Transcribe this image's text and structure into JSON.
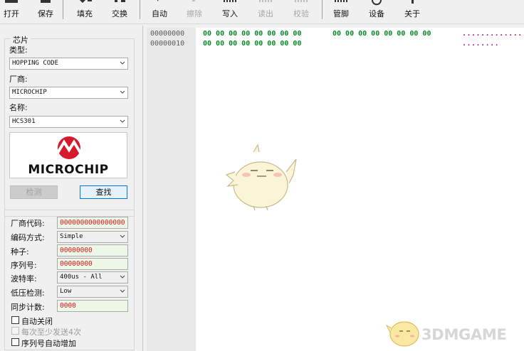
{
  "toolbar": {
    "open": "打开",
    "save": "保存",
    "fill": "填充",
    "swap": "交换",
    "auto": "自动",
    "erase": "擦除",
    "write": "写入",
    "read": "读出",
    "verify": "校验",
    "pins": "管脚",
    "device": "设备",
    "about": "关于"
  },
  "chip": {
    "group_title": "芯片",
    "type_label": "类型:",
    "type_value": "HOPPING CODE",
    "maker_label": "厂商:",
    "maker_value": "MICROCHIP",
    "name_label": "名称:",
    "name_value": "HCS301",
    "logo_text": "MICROCHIP",
    "detect_button": "检测",
    "search_button": "查找"
  },
  "config": {
    "manufacturer_code_label": "厂商代码:",
    "manufacturer_code_value": "0000000000000000",
    "encoding_label": "编码方式:",
    "encoding_value": "Simple",
    "seed_label": "种子:",
    "seed_value": "00000000",
    "serial_label": "序列号:",
    "serial_value": "00000000",
    "baud_label": "波特率:",
    "baud_value": "400us - All",
    "low_voltage_label": "低压检测:",
    "low_voltage_value": "Low",
    "sync_label": "同步计数:",
    "sync_value": "0000",
    "auto_close_label": "自动关闭",
    "send_min_label": "每次至少发送4次",
    "serial_auto_label": "序列号自动增加"
  },
  "hex": {
    "rows": [
      {
        "address": "00000000",
        "bytes_a": "00 00 00 00 00 00 00 00",
        "bytes_b": "00 00 00 00 00 00 00 00",
        "ascii": "................"
      },
      {
        "address": "00000010",
        "bytes_a": "00 00 00 00 00 00 00 00",
        "bytes_b": "",
        "ascii": "........"
      }
    ]
  },
  "watermark": {
    "text": "3DMGAME"
  },
  "colors": {
    "hex_bytes": "#0a8a2a",
    "ascii": "#a0178e",
    "logo_red": "#d7192d",
    "code_red": "#e01616",
    "input_green_bg": "#ecf7e8",
    "primary_border": "#0078d7"
  }
}
